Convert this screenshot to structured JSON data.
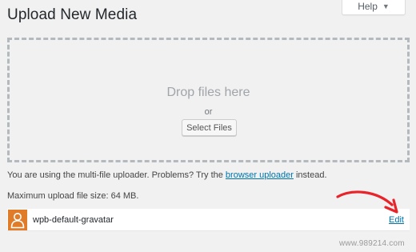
{
  "page": {
    "title": "Upload New Media"
  },
  "help_tab": {
    "label": "Help",
    "caret_icon": "caret-down-icon"
  },
  "uploader": {
    "drop_title": "Drop files here",
    "or_text": "or",
    "select_button": "Select Files"
  },
  "info": {
    "multi_prefix": "You are using the multi-file uploader. Problems? Try the",
    "browser_link": "browser uploader",
    "multi_suffix": "instead.",
    "max_size": "Maximum upload file size: 64 MB."
  },
  "media_item": {
    "thumbnail_icon": "default-avatar-icon",
    "thumbnail_color": "#e07b2a",
    "filename": "wpb-default-gravatar",
    "edit_label": "Edit"
  },
  "annotation": {
    "arrow_color": "#e8232a"
  },
  "watermark": {
    "text": "www.989214.com"
  }
}
